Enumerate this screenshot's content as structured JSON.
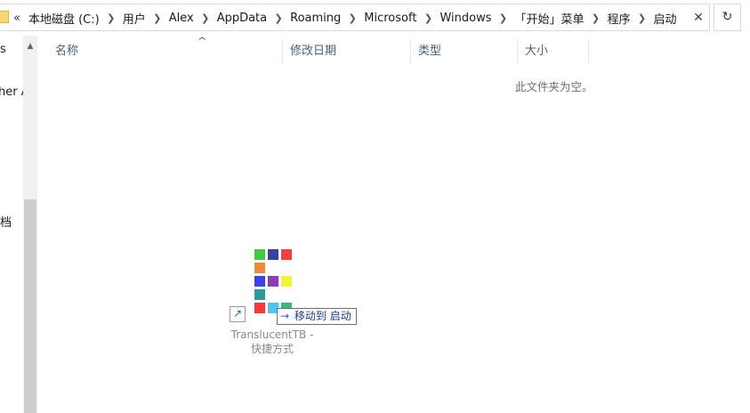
{
  "address_bar": {
    "overflow": "«",
    "crumbs": [
      "本地磁盘 (C:)",
      "用户",
      "Alex",
      "AppData",
      "Roaming",
      "Microsoft",
      "Windows",
      "「开始」菜单",
      "程序",
      "启动"
    ],
    "clear": "✕",
    "refresh": "↻"
  },
  "nav": {
    "items": [
      "s",
      "her A",
      "档"
    ],
    "scroll_up": "▲"
  },
  "columns": {
    "name": "名称",
    "modified": "修改日期",
    "type": "类型",
    "size": "大小",
    "sort_indicator": "^"
  },
  "empty_message": "此文件夹为空。",
  "drag": {
    "label_line1": "TranslucentTB -",
    "label_line2": "快捷方式",
    "tooltip_arrow": "→",
    "tooltip_action": "移动到",
    "tooltip_target": "启动",
    "tile_colors": [
      "#45c744",
      "#3a3fa3",
      "#f24040",
      "#f08a3a",
      "#3f3fe6",
      "#8a3db5",
      "#f2f23a",
      "#2e9a9a",
      "#f23a3a",
      "#4fc3f0",
      "#3ab87a"
    ]
  }
}
